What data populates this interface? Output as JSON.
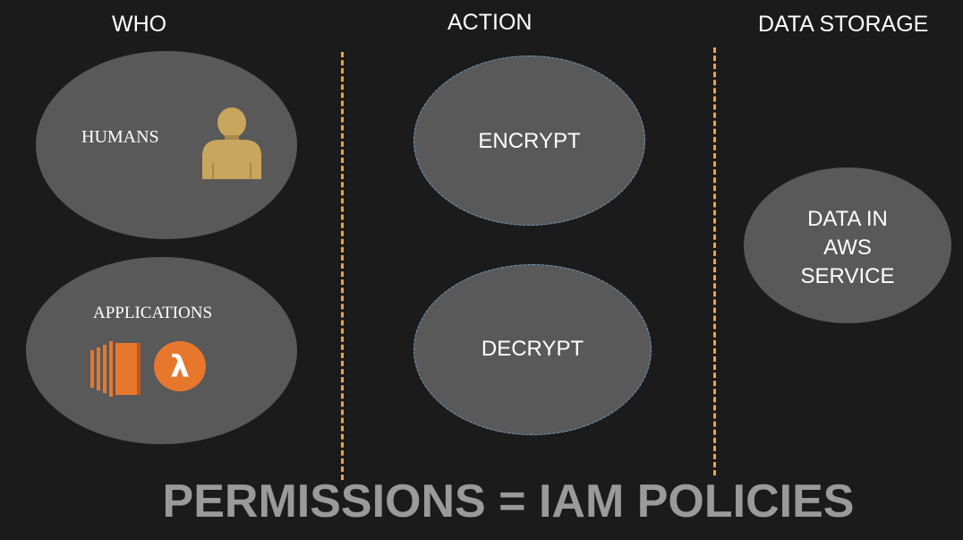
{
  "headers": {
    "who": "WHO",
    "action": "ACTION",
    "storage": "DATA STORAGE"
  },
  "who": {
    "humans_label": "HUMANS",
    "applications_label": "APPLICATIONS",
    "icons": [
      "user-icon",
      "ec2-server-icon",
      "lambda-icon"
    ]
  },
  "action": {
    "encrypt_label": "ENCRYPT",
    "decrypt_label": "DECRYPT"
  },
  "storage": {
    "line1": "DATA IN",
    "line2": "AWS",
    "line3": "SERVICE"
  },
  "footer": {
    "text": "PERMISSIONS = IAM POLICIES"
  },
  "colors": {
    "background": "#1b1b1b",
    "ellipse": "#595959",
    "divider": "#f0a43a",
    "user_icon": "#c9a65d",
    "aws_orange": "#e8772e",
    "footer_text": "#9a9a9a"
  }
}
